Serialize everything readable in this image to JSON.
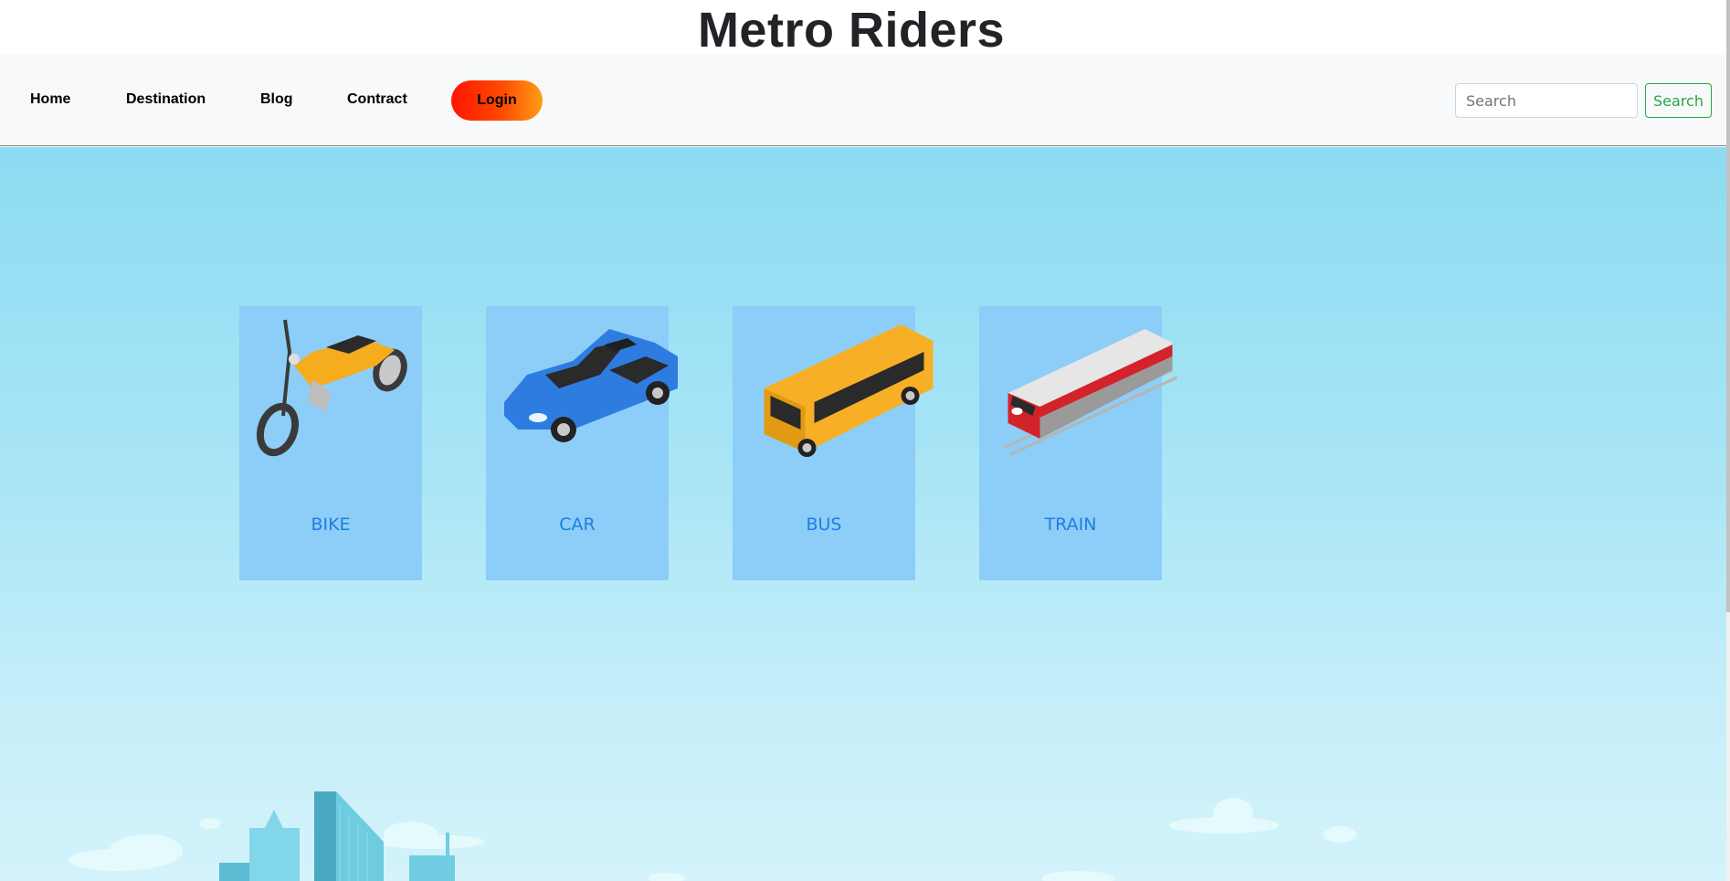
{
  "header": {
    "title": "Metro Riders"
  },
  "nav": {
    "items": [
      {
        "label": "Home"
      },
      {
        "label": "Destination"
      },
      {
        "label": "Blog"
      },
      {
        "label": "Contract"
      }
    ],
    "login_label": "Login",
    "search_placeholder": "Search",
    "search_button_label": "Search"
  },
  "cards": [
    {
      "label": "BIKE",
      "icon": "motorcycle-icon"
    },
    {
      "label": "CAR",
      "icon": "car-icon"
    },
    {
      "label": "BUS",
      "icon": "bus-icon"
    },
    {
      "label": "TRAIN",
      "icon": "train-icon"
    }
  ],
  "colors": {
    "login_gradient": [
      "#ff1500",
      "#ff9d16"
    ],
    "search_button": "#28a745",
    "card_background": "#8ccef7",
    "card_label": "#1f7ee0",
    "hero_sky": "#8cdcf2"
  }
}
